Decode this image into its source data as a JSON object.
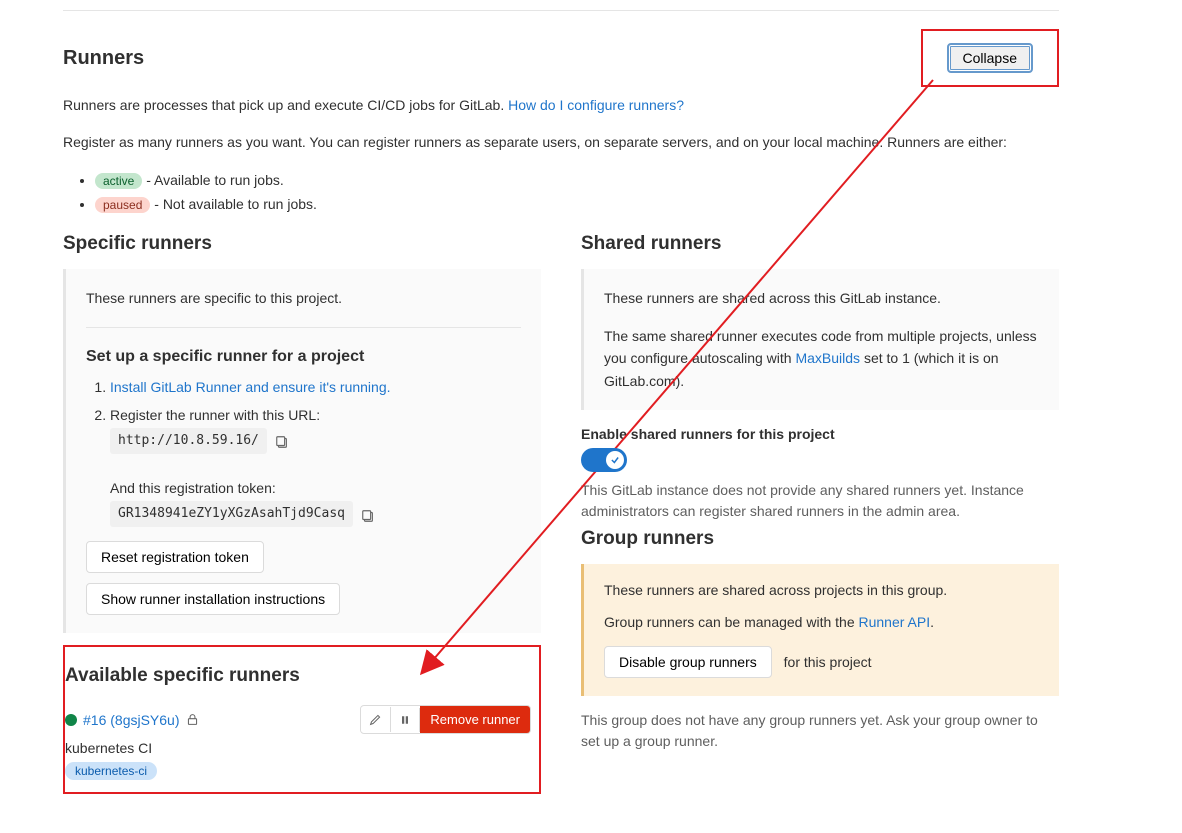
{
  "header": {
    "title": "Runners",
    "collapse": "Collapse"
  },
  "intro": {
    "line1a": "Runners are processes that pick up and execute CI/CD jobs for GitLab. ",
    "link1": "How do I configure runners?",
    "line2": "Register as many runners as you want. You can register runners as separate users, on separate servers, and on your local machine. Runners are either:"
  },
  "statuses": {
    "active_label": "active",
    "active_desc": " - Available to run jobs.",
    "paused_label": "paused",
    "paused_desc": " - Not available to run jobs."
  },
  "specific": {
    "title": "Specific runners",
    "note": "These runners are specific to this project.",
    "setup_title": "Set up a specific runner for a project",
    "step1_link": "Install GitLab Runner and ensure it's running.",
    "step2": "Register the runner with this URL:",
    "url": "http://10.8.59.16/",
    "token_label": "And this registration token:",
    "token": "GR1348941eZY1yXGzAsahTjd9Casq",
    "reset_btn": "Reset registration token",
    "instructions_btn": "Show runner installation instructions"
  },
  "available": {
    "title": "Available specific runners",
    "runner_id": "#16 (8gsjSY6u)",
    "remove": "Remove runner",
    "desc": "kubernetes CI",
    "tag": "kubernetes-ci"
  },
  "shared": {
    "title": "Shared runners",
    "note1": "These runners are shared across this GitLab instance.",
    "note2a": "The same shared runner executes code from multiple projects, unless you configure autoscaling with ",
    "note2_link": "MaxBuilds",
    "note2b": " set to 1 (which it is on GitLab.com).",
    "enable": "Enable shared runners for this project",
    "empty1": "This GitLab instance does not provide any shared runners yet. Instance administrators can register shared runners in the admin area."
  },
  "group": {
    "title": "Group runners",
    "note1": "These runners are shared across projects in this group.",
    "note2a": "Group runners can be managed with the ",
    "note2_link": "Runner API",
    "note2b": ".",
    "disable_btn": "Disable group runners",
    "after_btn": "for this project",
    "empty": "This group does not have any group runners yet. Ask your group owner to set up a group runner."
  }
}
